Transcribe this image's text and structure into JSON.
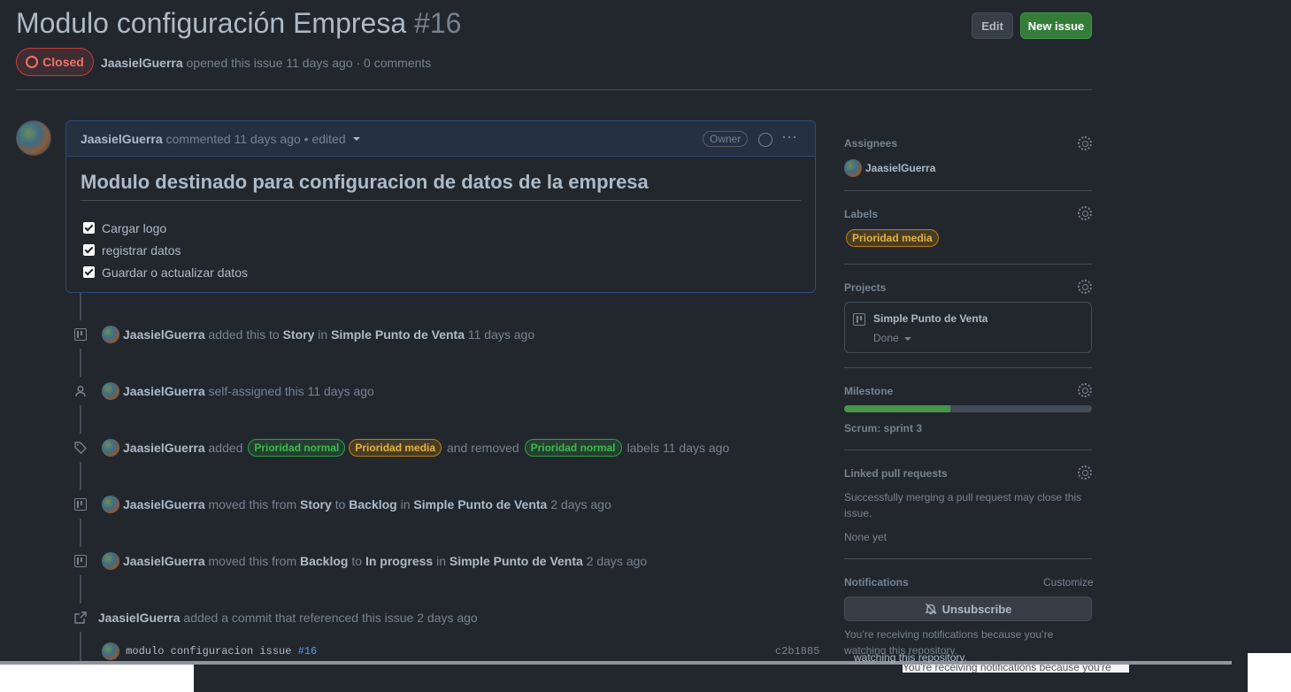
{
  "header": {
    "title": "Modulo configuración Empresa",
    "number": "#16",
    "edit_label": "Edit",
    "new_issue_label": "New issue"
  },
  "issue_state": {
    "state": "Closed",
    "author": "JaasielGuerra",
    "meta_text": "opened this issue 11 days ago · 0 comments"
  },
  "comment": {
    "author": "JaasielGuerra",
    "meta": "commented 11 days ago • edited",
    "badge": "Owner",
    "heading": "Modulo destinado para configuracion de datos de la empresa",
    "tasks": [
      "Cargar logo",
      "registrar datos",
      "Guardar o actualizar datos"
    ]
  },
  "timeline": [
    {
      "icon": "project-icon",
      "user": "JaasielGuerra",
      "parts": [
        "added this to",
        "Story",
        "in",
        "Simple Punto de Venta",
        "11 days ago"
      ]
    },
    {
      "icon": "person-icon",
      "user": "JaasielGuerra",
      "parts": [
        "self-assigned this",
        "11 days ago"
      ]
    },
    {
      "icon": "tag-icon",
      "user": "JaasielGuerra",
      "added": "added",
      "labels_added": [
        "Prioridad normal",
        "Prioridad media"
      ],
      "removed": "and removed",
      "labels_removed": [
        "Prioridad normal"
      ],
      "tail": "labels",
      "time": "11 days ago"
    },
    {
      "icon": "project-icon",
      "user": "JaasielGuerra",
      "parts": [
        "moved this from",
        "Story",
        "to",
        "Backlog",
        "in",
        "Simple Punto de Venta",
        "2 days ago"
      ]
    },
    {
      "icon": "project-icon",
      "user": "JaasielGuerra",
      "parts": [
        "moved this from",
        "Backlog",
        "to",
        "In progress",
        "in",
        "Simple Punto de Venta",
        "2 days ago"
      ]
    },
    {
      "icon": "cross-reference-icon",
      "user": "JaasielGuerra",
      "parts": [
        "added a commit that referenced this issue",
        "2 days ago"
      ]
    }
  ],
  "commit": {
    "message": "modulo configuracion issue",
    "ref": "#16",
    "hash": "c2b1885"
  },
  "sidebar": {
    "assignees_title": "Assignees",
    "assignee": "JaasielGuerra",
    "labels_title": "Labels",
    "label": "Prioridad media",
    "projects_title": "Projects",
    "project_name": "Simple Punto de Venta",
    "project_status": "Done",
    "milestone_title": "Milestone",
    "milestone_progress": 0.43,
    "milestone_name": "Scrum: sprint 3",
    "linked_title": "Linked pull requests",
    "linked_desc": "Successfully merging a pull request may close this issue.",
    "linked_none": "None yet",
    "notifications_title": "Notifications",
    "customize_label": "Customize",
    "unsubscribe_label": "Unsubscribe",
    "notification_desc": "You’re receiving notifications because you’re watching this repository.",
    "ghost_1": "watching this repository.",
    "ghost_2": "You're receiving notifications because you're"
  },
  "colors": {
    "background": "#22272e",
    "closed_red": "#f47067",
    "green_button": "#347d39",
    "label_normal": "#3fb950",
    "label_media": "#e3b341"
  }
}
